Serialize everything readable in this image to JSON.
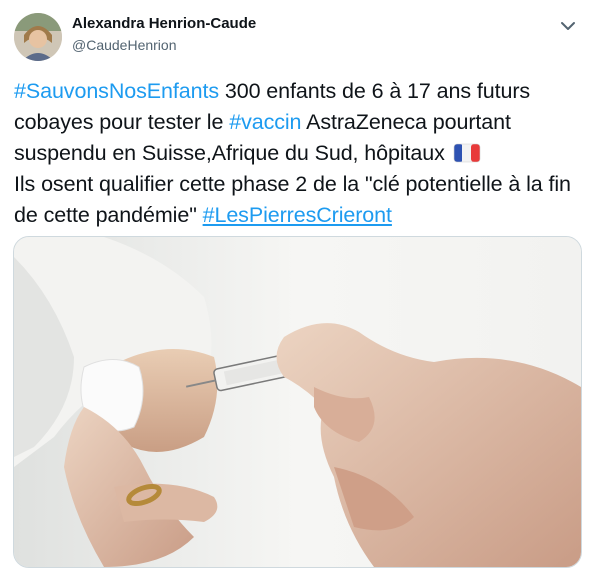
{
  "author": {
    "name": "Alexandra Henrion-Caude",
    "handle": "@CaudeHenrion"
  },
  "tweet": {
    "hashtag1": "#SauvonsNosEnfants",
    "text1": " 300 enfants de 6 à 17 ans futurs cobayes pour tester le ",
    "hashtag2": "#vaccin",
    "text2": " AstraZeneca pourtant suspendu en Suisse,Afrique du Sud, hôpitaux ",
    "text3": "Ils osent qualifier cette phase 2 de la \"clé potentielle à la fin de cette pandémie\" ",
    "hashtag3": "#LesPierresCrieront"
  },
  "icons": {
    "more": "chevron-down-icon",
    "flag": "france-flag-emoji"
  },
  "colors": {
    "link": "#1d9bf0",
    "text": "#0f1419",
    "secondary": "#536471"
  }
}
